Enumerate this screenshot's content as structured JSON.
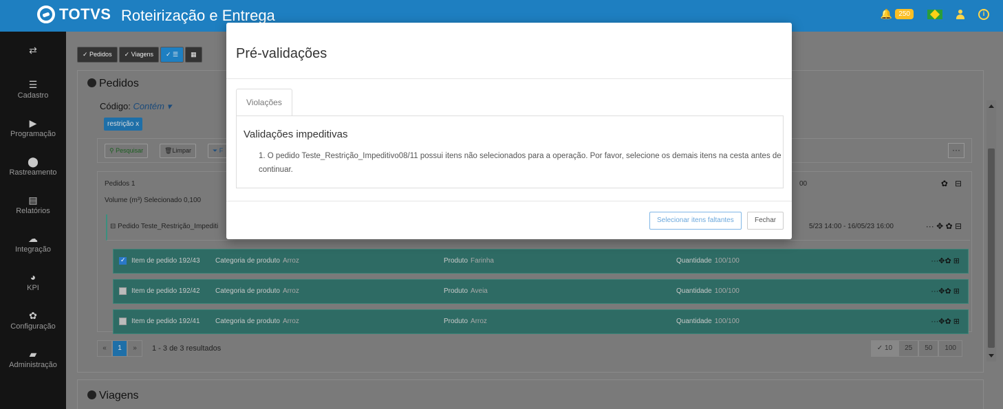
{
  "header": {
    "brand": "TOTVS",
    "app_title": "Roteirização e Entrega",
    "notifications_count": "250",
    "icons": {
      "bell": "bell-icon",
      "flag": "brazil-flag-icon",
      "user": "user-icon",
      "info": "info-icon"
    },
    "accent_color": "#1e7fc1"
  },
  "sidebar": {
    "items": [
      {
        "label": "",
        "icon": "swap-icon"
      },
      {
        "label": "Cadastro",
        "icon": "list-icon"
      },
      {
        "label": "Programação",
        "icon": "play-icon"
      },
      {
        "label": "Rastreamento",
        "icon": "map-marker-icon"
      },
      {
        "label": "Relatórios",
        "icon": "report-icon"
      },
      {
        "label": "Integração",
        "icon": "cloud-icon"
      },
      {
        "label": "KPI",
        "icon": "pie-chart-icon"
      },
      {
        "label": "Configuração",
        "icon": "gear-icon"
      },
      {
        "label": "Administração",
        "icon": "briefcase-icon"
      }
    ]
  },
  "toolbar": {
    "pedidos_label": "✓ Pedidos",
    "viagens_label": "✓ Viagens"
  },
  "pedidos_panel": {
    "title": "Pedidos",
    "code_label": "Código:",
    "code_operator": "Contém ▾",
    "filter_tag": "restrição x",
    "search_label": "Pesquisar",
    "clear_label": "Limpar",
    "filter_label": "F",
    "more_label": "···",
    "orders_label": "Pedidos  1",
    "volume_label": "Volume (m³) Selecionado  0,100",
    "partial_number": "00",
    "order": {
      "label": "Pedido Teste_Restrição_Impediti",
      "dates": "5/23 14:00 - 16/05/23 16:00"
    },
    "items": [
      {
        "checked": true,
        "item": "Item de pedido 192/43",
        "category_key": "Categoria de produto",
        "category": "Arroz",
        "product_key": "Produto",
        "product": "Farinha",
        "qty_key": "Quantidade",
        "qty": "100/100"
      },
      {
        "checked": false,
        "item": "Item de pedido 192/42",
        "category_key": "Categoria de produto",
        "category": "Arroz",
        "product_key": "Produto",
        "product": "Aveia",
        "qty_key": "Quantidade",
        "qty": "100/100"
      },
      {
        "checked": false,
        "item": "Item de pedido 192/41",
        "category_key": "Categoria de produto",
        "category": "Arroz",
        "product_key": "Produto",
        "product": "Arroz",
        "qty_key": "Quantidade",
        "qty": "100/100"
      }
    ],
    "pagination": {
      "prev": "«",
      "current": "1",
      "next": "»",
      "results": "1 - 3 de 3 resultados",
      "page_sizes": [
        "✓ 10",
        "25",
        "50",
        "100"
      ]
    }
  },
  "viagens_panel": {
    "title": "Viagens"
  },
  "modal": {
    "title": "Pré-validações",
    "tab_label": "Violações",
    "section_title": "Validações impeditivas",
    "message": "1. O pedido Teste_Restrição_Impeditivo08/11 possui itens não selecionados para a operação. Por favor, selecione os demais itens na cesta antes de continuar.",
    "select_missing_label": "Selecionar itens faltantes",
    "close_label": "Fechar"
  }
}
